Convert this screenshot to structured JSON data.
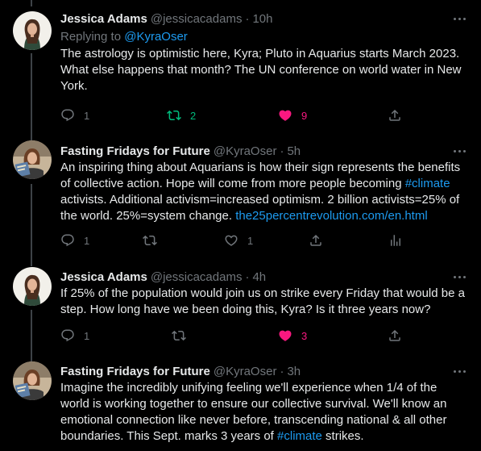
{
  "tweets": [
    {
      "name": "Jessica Adams",
      "handle": "@jessicacadams",
      "dot": "·",
      "time": "10h",
      "replying_prefix": "Replying to ",
      "replying_to": "@KyraOser",
      "text_lines": [
        "The astrology is optimistic here, Kyra; Pluto in Aquarius starts March 2023.",
        "What else happens that month? The UN conference on world water in New",
        "York."
      ],
      "replies": "1",
      "retweets": "2",
      "likes": "9",
      "retweeted": true,
      "liked": true
    },
    {
      "name": "Fasting Fridays for Future",
      "handle": "@KyraOser",
      "dot": "·",
      "time": "5h",
      "text_parts": {
        "line1": "An inspiring thing about Aquarians is how their sign represents the benefits",
        "line2": "of collective action. Hope will come from more people becoming ",
        "hashtag": "#climate",
        "line3": "activists. Additional activism=increased optimism. 2 billion activists=25% of",
        "line4": "the world. 25%=system change. ",
        "url": "the25percentrevolution.com/en.html"
      },
      "replies": "1",
      "retweets": "",
      "likes": "1"
    },
    {
      "name": "Jessica Adams",
      "handle": "@jessicacadams",
      "dot": "·",
      "time": "4h",
      "text_lines": [
        "If 25% of the population would join us on strike every Friday that would be a",
        "step. How long have we been doing this, Kyra? Is it three years now?"
      ],
      "replies": "1",
      "retweets": "",
      "likes": "3",
      "liked": true
    },
    {
      "name": "Fasting Fridays for Future",
      "handle": "@KyraOser",
      "dot": "·",
      "time": "3h",
      "text_parts": {
        "line1": "Imagine the incredibly unifying feeling we'll experience when 1/4 of the",
        "line2": "world is working together to ensure our collective survival. We'll know an",
        "line3": "emotional connection like never before, transcending national & all other",
        "line4": "boundaries. This Sept. marks 3 years of ",
        "hashtag": "#climate",
        "line4_end": " strikes."
      }
    }
  ],
  "colors": {
    "background": "#000000",
    "text": "#e7e9ea",
    "muted": "#71767b",
    "link": "#1d9bf0",
    "retweet": "#00ba7c",
    "like": "#f91880"
  },
  "icons": [
    "reply-icon",
    "retweet-icon",
    "like-icon",
    "share-icon",
    "analytics-icon",
    "more-icon"
  ]
}
